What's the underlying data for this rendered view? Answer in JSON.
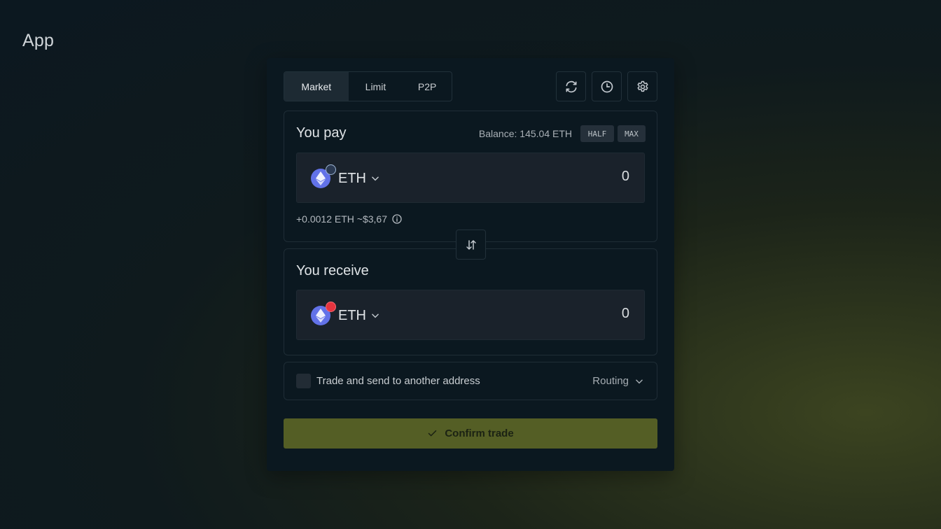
{
  "app": {
    "title": "App"
  },
  "tabs": [
    {
      "label": "Market",
      "active": true
    },
    {
      "label": "Limit",
      "active": false
    },
    {
      "label": "P2P",
      "active": false
    }
  ],
  "toolbar_icons": [
    "refresh-icon",
    "history-icon",
    "settings-icon"
  ],
  "pay": {
    "title": "You pay",
    "balance": "Balance: 145.04 ETH",
    "half_label": "HALF",
    "max_label": "MAX",
    "token": "ETH",
    "token_badge": "arbitrum-badge-icon",
    "amount": "0",
    "fee_text": "+0.0012 ETH ~$3,67"
  },
  "receive": {
    "title": "You receive",
    "token": "ETH",
    "token_badge": "optimism-badge-icon",
    "amount": "0"
  },
  "options": {
    "checkbox_label": "Trade and send to another address",
    "checked": false,
    "routing_label": "Routing"
  },
  "confirm": {
    "label": "Confirm trade"
  },
  "colors": {
    "accent": "#545e25",
    "card_bg": "#0b1820",
    "token_bg": "#1a222b",
    "eth": "#6272e8"
  }
}
